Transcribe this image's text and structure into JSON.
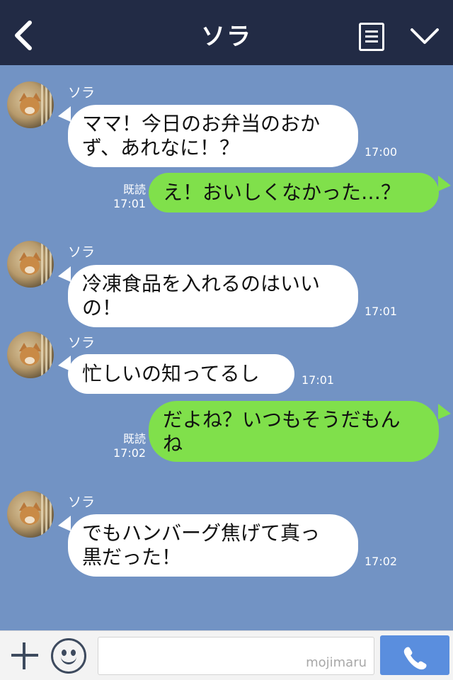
{
  "header": {
    "title": "ソラ",
    "back_icon": "chevron-left-icon",
    "menu_icon": "menu-list-icon",
    "collapse_icon": "chevron-down-icon",
    "bg_color": "#222b45"
  },
  "chat": {
    "bg_color": "#7293c4",
    "messages": [
      {
        "side": "left",
        "sender": "ソラ",
        "text": "ママ！今日のお弁当のおか\nず、あれなに！？",
        "time": "17:00"
      },
      {
        "side": "right",
        "text": "え！おいしくなかった…？",
        "read": "既読",
        "time": "17:01"
      },
      {
        "side": "left",
        "sender": "ソラ",
        "text": "冷凍食品を入れるのはいい\nの！",
        "time": "17:01"
      },
      {
        "side": "left",
        "sender": "ソラ",
        "text": "忙しいの知ってるし",
        "time": "17:01"
      },
      {
        "side": "right",
        "text": "だよね？いつもそうだもん\nね",
        "read": "既読",
        "time": "17:02"
      },
      {
        "side": "left",
        "sender": "ソラ",
        "text": "でもハンバーグ焦げて真っ\n黒だった！",
        "time": "17:02"
      }
    ]
  },
  "composer": {
    "add_icon": "plus-icon",
    "emoji_icon": "smiley-icon",
    "watermark": "mojimaru",
    "call_icon": "phone-icon",
    "call_color": "#5a8ede"
  }
}
